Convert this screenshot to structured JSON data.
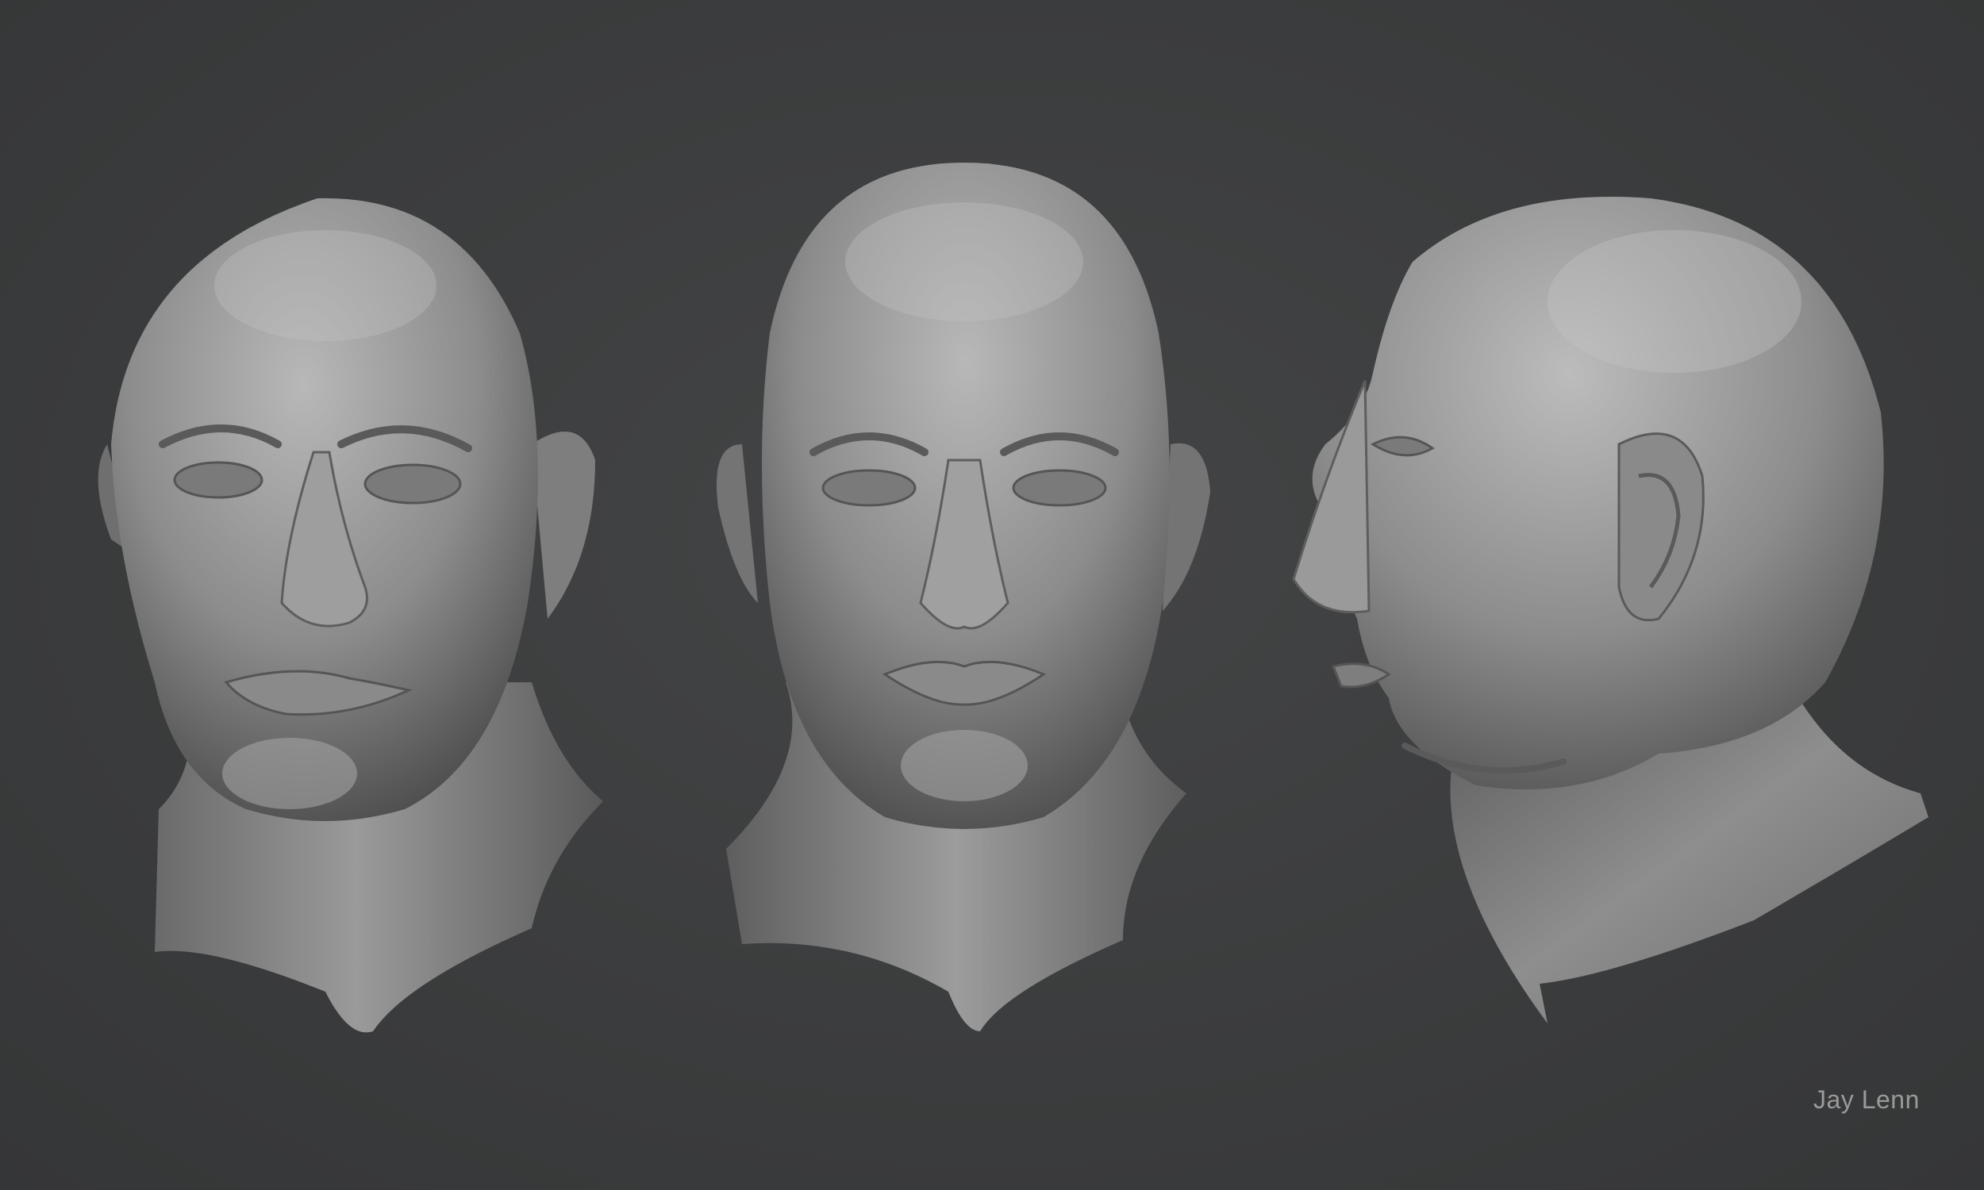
{
  "artwork": {
    "signature": "Jay Lenn",
    "views": [
      {
        "view": "three-quarter"
      },
      {
        "view": "front"
      },
      {
        "view": "profile"
      }
    ]
  },
  "colors": {
    "background": "#3b3c3d",
    "clay_light": "#b4b4b4",
    "clay_mid": "#8a8a8a",
    "clay_dark": "#4c4c4c",
    "signature": "#9a9a9a"
  }
}
